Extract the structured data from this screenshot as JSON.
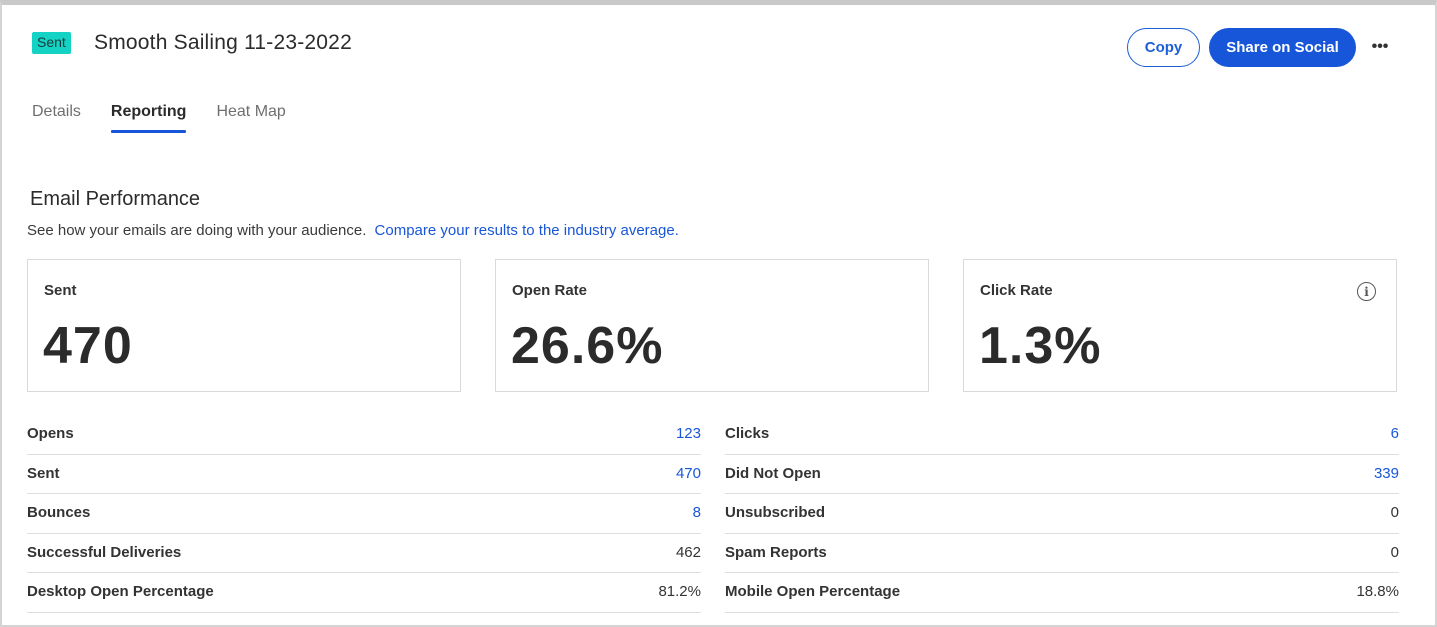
{
  "header": {
    "status_badge": "Sent",
    "title": "Smooth Sailing 11-23-2022",
    "copy_label": "Copy",
    "share_label": "Share on Social",
    "more_label": "•••"
  },
  "tabs": [
    {
      "label": "Details",
      "active": false
    },
    {
      "label": "Reporting",
      "active": true
    },
    {
      "label": "Heat Map",
      "active": false
    }
  ],
  "section": {
    "title": "Email Performance",
    "subtitle": "See how your emails are doing with your audience.",
    "link": "Compare your results to the industry average."
  },
  "cards": [
    {
      "label": "Sent",
      "value": "470"
    },
    {
      "label": "Open Rate",
      "value": "26.6%"
    },
    {
      "label": "Click Rate",
      "value": "1.3%",
      "info_icon": "info-icon"
    }
  ],
  "stats_left": [
    {
      "label": "Opens",
      "value": "123",
      "link": true
    },
    {
      "label": "Sent",
      "value": "470",
      "link": true
    },
    {
      "label": "Bounces",
      "value": "8",
      "link": true
    },
    {
      "label": "Successful Deliveries",
      "value": "462",
      "link": false
    },
    {
      "label": "Desktop Open Percentage",
      "value": "81.2%",
      "link": false
    }
  ],
  "stats_right": [
    {
      "label": "Clicks",
      "value": "6",
      "link": true
    },
    {
      "label": "Did Not Open",
      "value": "339",
      "link": true
    },
    {
      "label": "Unsubscribed",
      "value": "0",
      "link": false
    },
    {
      "label": "Spam Reports",
      "value": "0",
      "link": false
    },
    {
      "label": "Mobile Open Percentage",
      "value": "18.8%",
      "link": false
    }
  ],
  "colors": {
    "accent": "#1856d9",
    "badge": "#14d3c4",
    "border": "#d9d9d9"
  }
}
